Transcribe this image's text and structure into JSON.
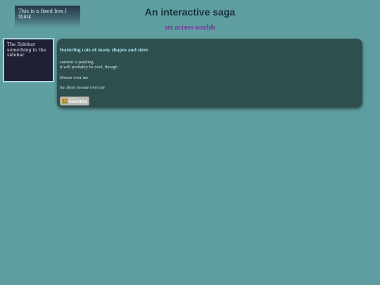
{
  "fixed_box": {
    "text": "This is a fixed box I think"
  },
  "header": {
    "title": "An interactive saga",
    "subtitle": "set across worlds"
  },
  "sidebar": {
    "line1": "The Sidebar",
    "line2": "something in the sidebar"
  },
  "main": {
    "heading": "featuring cats of many shapes and sizes",
    "content_line1": "content is pending.",
    "content_line2": "it will probably be cool, though",
    "hover_text": "Mouse over me",
    "no_hover_text": "but don't mouse over me",
    "badge": {
      "small_text": "hosted by",
      "main_text": "neocities",
      "icon": "cat-face-icon"
    }
  }
}
